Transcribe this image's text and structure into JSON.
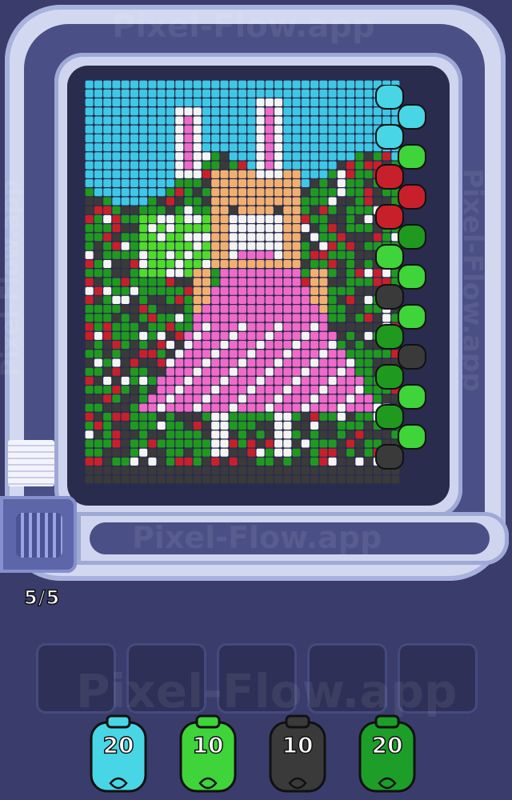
{
  "watermark": "Pixel-Flow.app",
  "capacity": "5/5",
  "colors": {
    "sky": "#3ec8e6",
    "white": "#f4f4f4",
    "pink": "#f06ac8",
    "tan": "#f2b070",
    "brown": "#9a5a2a",
    "green": "#4fdc2a",
    "darkgreen": "#1f9a1f",
    "red": "#c8202a",
    "dark": "#3a3a3a"
  },
  "slots": [
    {},
    {},
    {},
    {},
    {}
  ],
  "shooters": [
    {
      "count": "20",
      "color": "#48d6e6",
      "name": "cyan"
    },
    {
      "count": "10",
      "color": "#3ed43a",
      "name": "green"
    },
    {
      "count": "10",
      "color": "#3a3a3a",
      "name": "black"
    },
    {
      "count": "20",
      "color": "#1c9e28",
      "name": "darkgreen"
    }
  ]
}
